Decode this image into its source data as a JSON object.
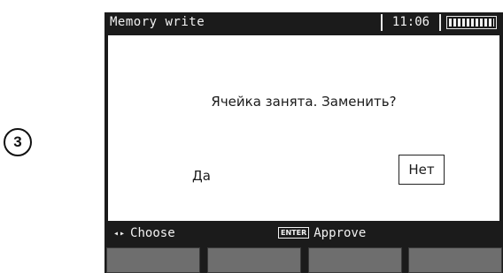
{
  "step": {
    "number": "3"
  },
  "titlebar": {
    "title": "Memory write",
    "clock": "11:06",
    "battery_level": 1.0
  },
  "dialog": {
    "message": "Ячейка занята. Заменить?",
    "yes_label": "Да",
    "no_label": "Нет"
  },
  "hints": {
    "left_arrows": "◂▸",
    "left_label": "Choose",
    "enter_key": "ENTER",
    "right_label": "Approve"
  },
  "softkeys": [
    {
      "label": ""
    },
    {
      "label": ""
    },
    {
      "label": ""
    },
    {
      "label": ""
    }
  ]
}
